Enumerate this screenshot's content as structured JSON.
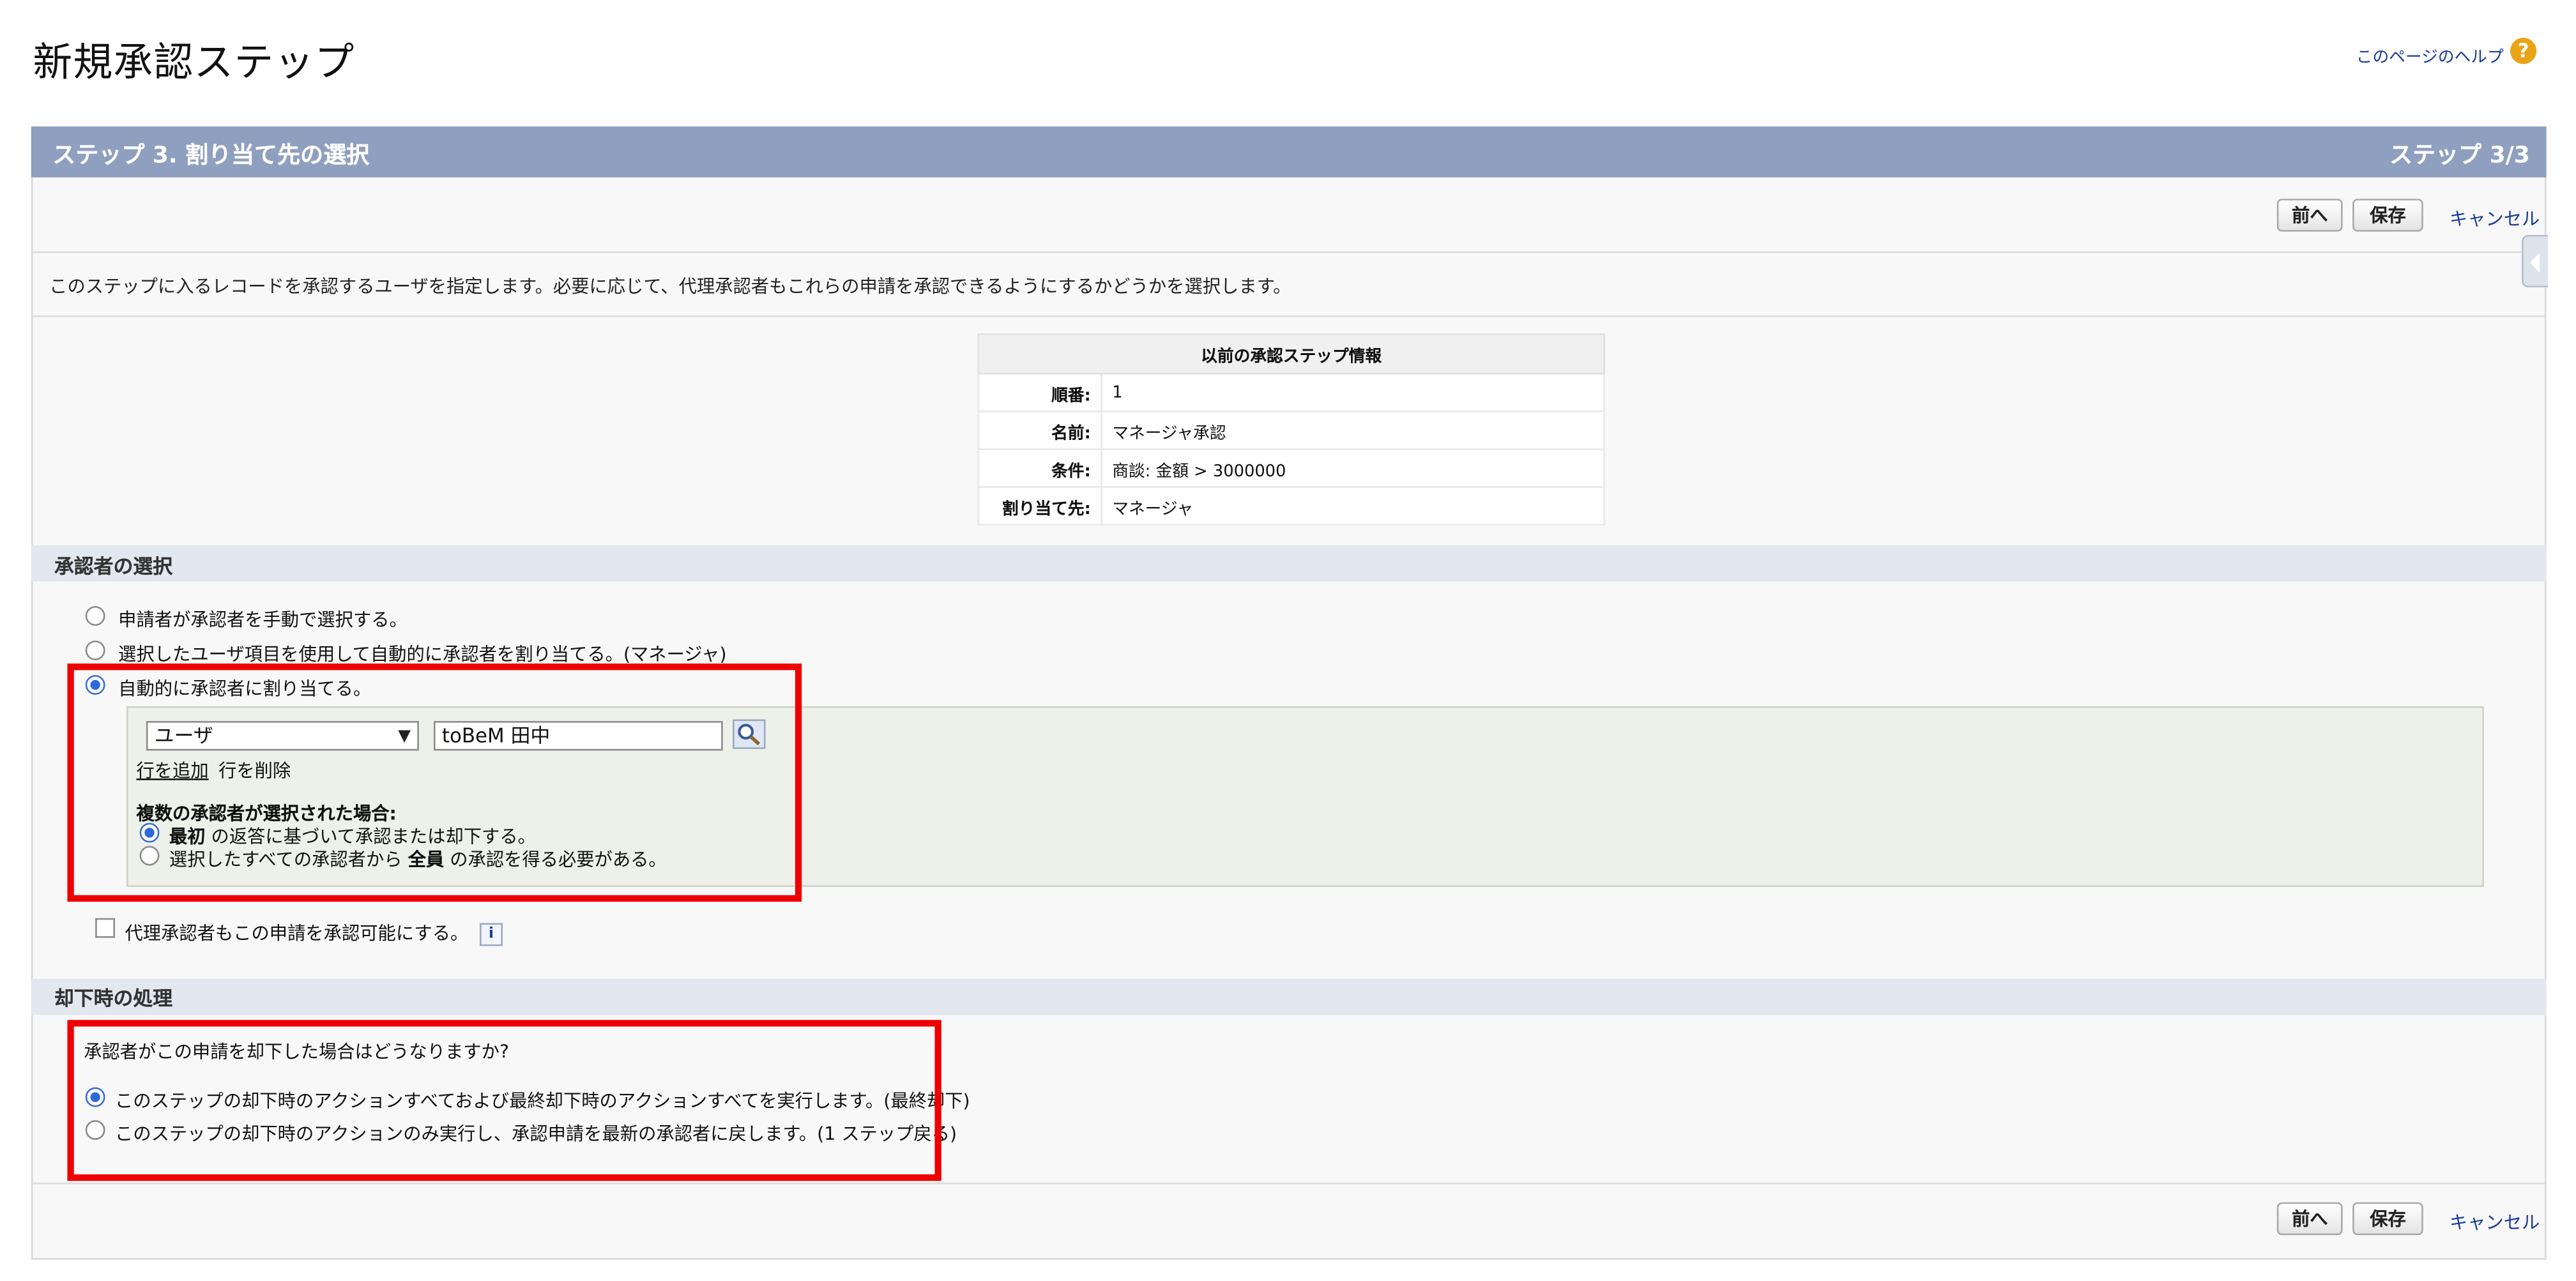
{
  "page": {
    "title": "新規承認ステップ",
    "help_link": "このページのヘルプ",
    "help_icon": "?"
  },
  "header": {
    "title": "ステップ 3. 割り当て先の選択",
    "step": "ステップ 3/3"
  },
  "buttons": {
    "prev": "前へ",
    "save": "保存",
    "cancel": "キャンセル"
  },
  "instruction": "このステップに入るレコードを承認するユーザを指定します。必要に応じて、代理承認者もこれらの申請を承認できるようにするかどうかを選択します。",
  "previous_step": {
    "heading": "以前の承認ステップ情報",
    "rows": [
      {
        "label": "順番:",
        "value": "1"
      },
      {
        "label": "名前:",
        "value": "マネージャ承認"
      },
      {
        "label": "条件:",
        "value": "商談: 金額 > 3000000"
      },
      {
        "label": "割り当て先:",
        "value": "マネージャ"
      }
    ]
  },
  "approver_section": {
    "heading": "承認者の選択",
    "options": [
      {
        "label": "申請者が承認者を手動で選択する。",
        "selected": false
      },
      {
        "label": "選択したユーザ項目を使用して自動的に承認者を割り当てる。(マネージャ)",
        "selected": false
      },
      {
        "label": "自動的に承認者に割り当てる。",
        "selected": true
      }
    ],
    "assign_type": "ユーザ",
    "assignee": "toBeM 田中",
    "add_row": "行を追加",
    "delete_row": "行を削除",
    "multi_heading": "複数の承認者が選択された場合:",
    "multi_options": [
      {
        "prefix": "",
        "bold": "最初",
        "suffix": " の返答に基づいて承認または却下する。",
        "selected": true
      },
      {
        "prefix": "選択したすべての承認者から ",
        "bold": "全員",
        "suffix": " の承認を得る必要がある。",
        "selected": false
      }
    ],
    "delegate_label": "代理承認者もこの申請を承認可能にする。",
    "delegate_checked": false,
    "info_icon": "i"
  },
  "reject_section": {
    "heading": "却下時の処理",
    "question": "承認者がこの申請を却下した場合はどうなりますか?",
    "options": [
      {
        "label": "このステップの却下時のアクションすべておよび最終却下時のアクションすべてを実行します。(最終却下)",
        "selected": true
      },
      {
        "label": "このステップの却下時のアクションのみ実行し、承認申請を最新の承認者に戻します。(1 ステップ戻る)",
        "selected": false
      }
    ]
  },
  "colors": {
    "header_bar": "#8f9fbf",
    "section_bar": "#e3e7ef",
    "highlight": "#ee0000",
    "link": "#1a3a9a"
  }
}
